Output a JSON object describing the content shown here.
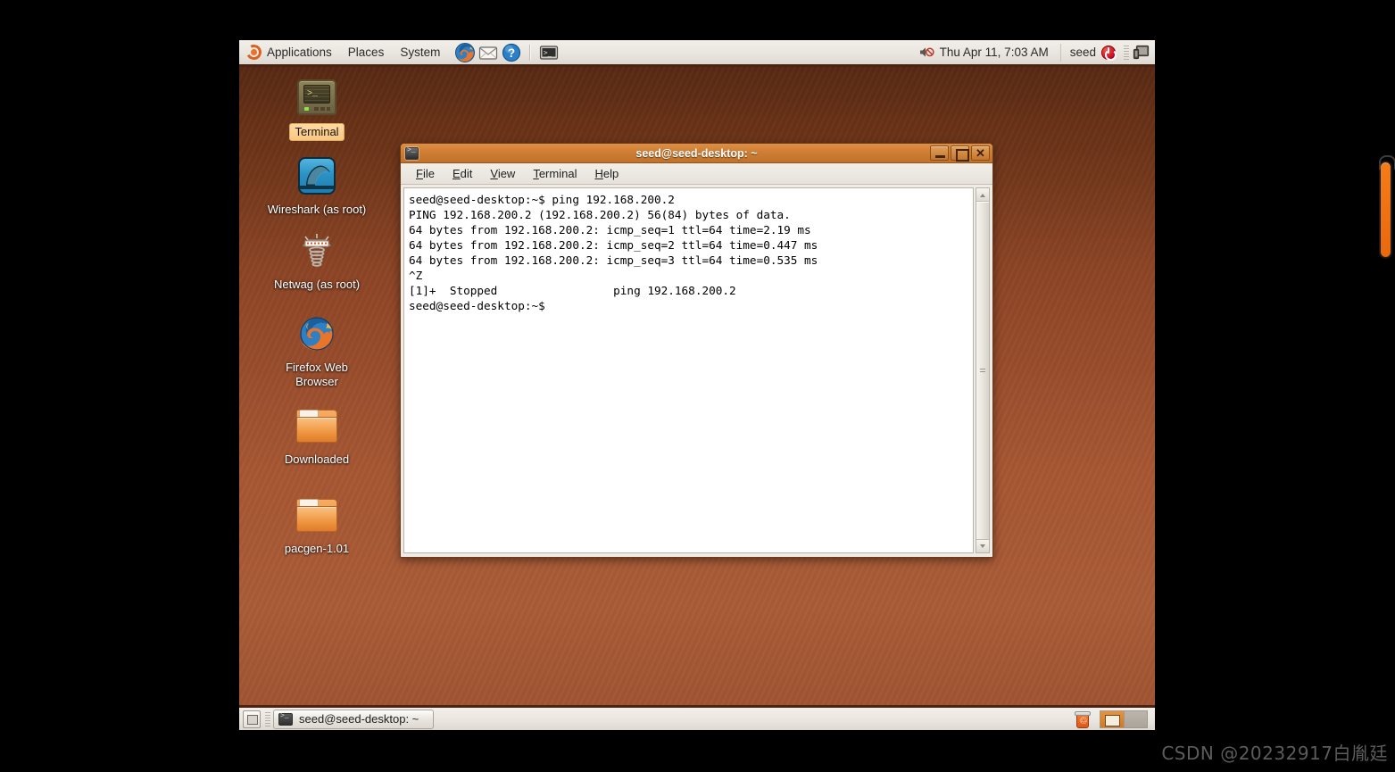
{
  "top_panel": {
    "menus": [
      {
        "label": "Applications",
        "icon": "ubuntu-logo-icon"
      },
      {
        "label": "Places",
        "icon": ""
      },
      {
        "label": "System",
        "icon": ""
      }
    ],
    "launchers": [
      {
        "name": "firefox-launcher-icon",
        "tooltip": "Firefox Web Browser"
      },
      {
        "name": "mail-launcher-icon",
        "tooltip": "Evolution Mail"
      },
      {
        "name": "help-launcher-icon",
        "tooltip": "Help"
      },
      {
        "name": "terminal-launcher-icon",
        "tooltip": "Terminal"
      }
    ],
    "volume_icon": "speaker-muted-icon",
    "clock": "Thu Apr 11,  7:03 AM",
    "user": "seed",
    "power_icon": "power-icon",
    "display_icon": "monitor-icon"
  },
  "desktop": {
    "icons": [
      {
        "label": "Terminal",
        "icon": "terminal-crt-icon",
        "selected": true
      },
      {
        "label": "Wireshark (as root)",
        "icon": "wireshark-fin-icon",
        "selected": false
      },
      {
        "label": "Netwag (as root)",
        "icon": "netwag-icon",
        "selected": false
      },
      {
        "label": "Firefox Web Browser",
        "icon": "firefox-icon",
        "selected": false
      },
      {
        "label": "Downloaded",
        "icon": "folder-icon",
        "selected": false
      },
      {
        "label": "pacgen-1.01",
        "icon": "folder-icon",
        "selected": false
      }
    ]
  },
  "terminal_window": {
    "title": "seed@seed-desktop: ~",
    "title_icon": "terminal-icon",
    "menu": [
      {
        "label": "File",
        "accel": "F"
      },
      {
        "label": "Edit",
        "accel": "E"
      },
      {
        "label": "View",
        "accel": "V"
      },
      {
        "label": "Terminal",
        "accel": "T"
      },
      {
        "label": "Help",
        "accel": "H"
      }
    ],
    "buttons": {
      "minimize": "minimize-icon",
      "maximize": "maximize-icon",
      "close": "close-icon"
    },
    "content": "seed@seed-desktop:~$ ping 192.168.200.2\nPING 192.168.200.2 (192.168.200.2) 56(84) bytes of data.\n64 bytes from 192.168.200.2: icmp_seq=1 ttl=64 time=2.19 ms\n64 bytes from 192.168.200.2: icmp_seq=2 ttl=64 time=0.447 ms\n64 bytes from 192.168.200.2: icmp_seq=3 ttl=64 time=0.535 ms\n^Z\n[1]+  Stopped                 ping 192.168.200.2\nseed@seed-desktop:~$",
    "ping": {
      "command": "ping 192.168.200.2",
      "target": "192.168.200.2",
      "packet_size_bytes": 56,
      "packet_total_bytes": 84,
      "reply_bytes": 64,
      "replies": [
        {
          "icmp_seq": 1,
          "ttl": 64,
          "time_ms": 2.19
        },
        {
          "icmp_seq": 2,
          "ttl": 64,
          "time_ms": 0.447
        },
        {
          "icmp_seq": 3,
          "ttl": 64,
          "time_ms": 0.535
        }
      ],
      "interrupt": "^Z",
      "job_status": "[1]+  Stopped",
      "job_command": "ping 192.168.200.2",
      "prompt": "seed@seed-desktop:~$"
    }
  },
  "bottom_panel": {
    "show_desktop_icon": "show-desktop-icon",
    "tasks": [
      {
        "label": "seed@seed-desktop: ~",
        "icon": "terminal-icon",
        "active": true
      }
    ],
    "trash_icon": "trash-icon",
    "workspaces": [
      {
        "name": "workspace-1",
        "active": true
      },
      {
        "name": "workspace-2",
        "active": false
      }
    ]
  },
  "watermark": "CSDN @20232917白胤廷",
  "colors": {
    "panel_bg": "#ece9e4",
    "panel_border": "#4a2410",
    "titlebar": "#cf7e33",
    "desktop_top": "#4e2512",
    "desktop_bottom": "#a75733",
    "accent_orange": "#f57c18",
    "selected_label_bg": "#f6c884"
  }
}
